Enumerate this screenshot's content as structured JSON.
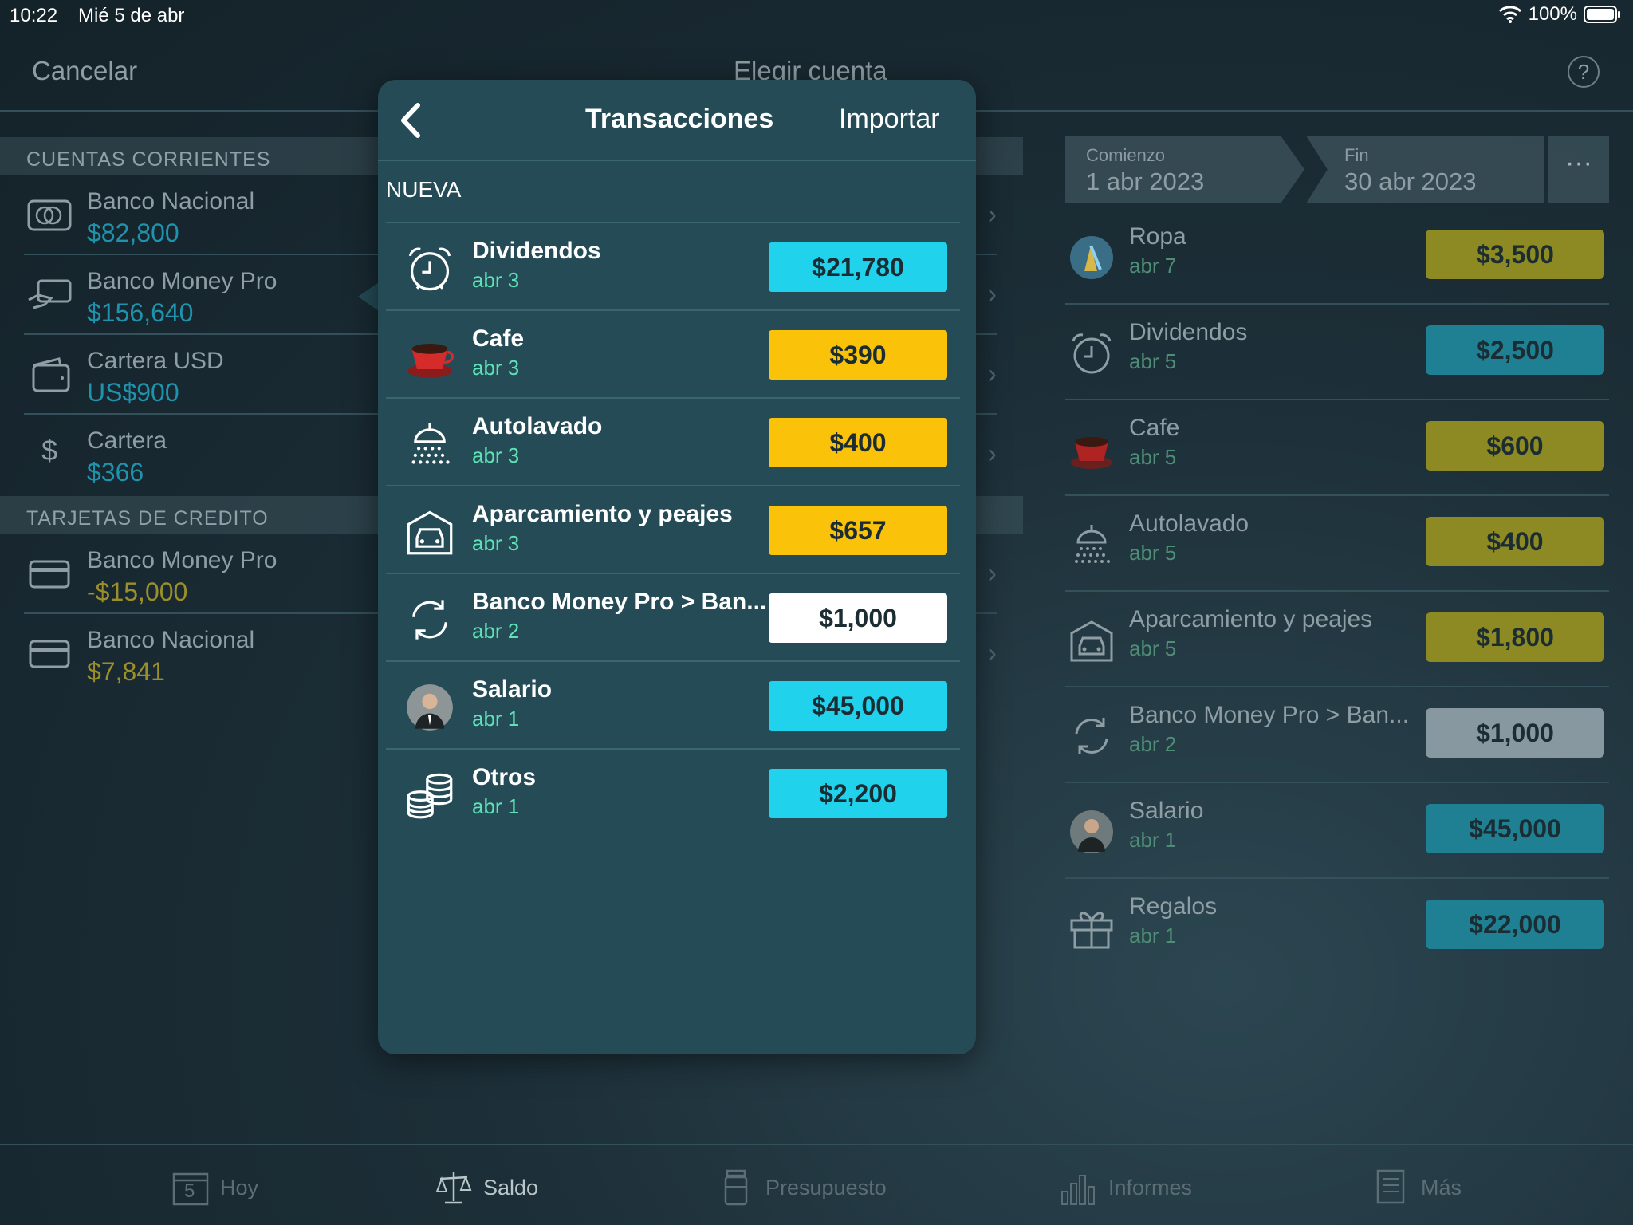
{
  "status": {
    "time": "10:22",
    "date": "Mié 5 de abr",
    "battery": "100%"
  },
  "nav": {
    "cancel": "Cancelar",
    "title": "Elegir cuenta",
    "help": "?"
  },
  "sections": {
    "current": "CUENTAS CORRIENTES",
    "credit": "TARJETAS DE CREDITO"
  },
  "accounts": [
    {
      "name": "Banco Nacional",
      "amount": "$82,800",
      "icon": "bank-card-icon"
    },
    {
      "name": "Banco Money Pro",
      "amount": "$156,640",
      "icon": "hand-card-icon"
    },
    {
      "name": "Cartera USD",
      "amount": "US$900",
      "icon": "wallet-icon"
    },
    {
      "name": "Cartera",
      "amount": "$366",
      "icon": "dollar-icon"
    }
  ],
  "credit_accounts": [
    {
      "name": "Banco Money Pro",
      "amount": "-$15,000",
      "icon": "credit-card-icon"
    },
    {
      "name": "Banco Nacional",
      "amount": "$7,841",
      "icon": "credit-card-icon"
    }
  ],
  "period": {
    "start_label": "Comienzo",
    "start": "1 abr 2023",
    "end_label": "Fin",
    "end": "30 abr 2023",
    "more": "···"
  },
  "right_transactions": [
    {
      "name": "Ropa",
      "date": "abr 7",
      "amount": "$3,500",
      "icon": "clothing-icon"
    },
    {
      "name": "Dividendos",
      "date": "abr 5",
      "amount": "$2,500",
      "icon": "alarm-clock-icon"
    },
    {
      "name": "Cafe",
      "date": "abr 5",
      "amount": "$600",
      "icon": "coffee-cup-icon"
    },
    {
      "name": "Autolavado",
      "date": "abr 5",
      "amount": "$400",
      "icon": "car-wash-icon"
    },
    {
      "name": "Aparcamiento y peajes",
      "date": "abr 5",
      "amount": "$1,800",
      "icon": "garage-car-icon"
    },
    {
      "name": "Banco Money Pro > Ban...",
      "date": "abr 2",
      "amount": "$1,000",
      "icon": "transfer-icon"
    },
    {
      "name": "Salario",
      "date": "abr 1",
      "amount": "$45,000",
      "icon": "person-avatar-icon"
    },
    {
      "name": "Regalos",
      "date": "abr 1",
      "amount": "$22,000",
      "icon": "gift-icon"
    }
  ],
  "popover": {
    "title": "Transacciones",
    "import": "Importar",
    "section": "NUEVA",
    "transactions": [
      {
        "name": "Dividendos",
        "date": "abr 3",
        "amount": "$21,780",
        "icon": "alarm-clock-icon"
      },
      {
        "name": "Cafe",
        "date": "abr 3",
        "amount": "$390",
        "icon": "coffee-cup-icon"
      },
      {
        "name": "Autolavado",
        "date": "abr 3",
        "amount": "$400",
        "icon": "car-wash-icon"
      },
      {
        "name": "Aparcamiento y peajes",
        "date": "abr 3",
        "amount": "$657",
        "icon": "garage-car-icon"
      },
      {
        "name": "Banco Money Pro > Ban...",
        "date": "abr 2",
        "amount": "$1,000",
        "icon": "transfer-icon"
      },
      {
        "name": "Salario",
        "date": "abr 1",
        "amount": "$45,000",
        "icon": "person-avatar-icon"
      },
      {
        "name": "Otros",
        "date": "abr 1",
        "amount": "$2,200",
        "icon": "coins-icon"
      }
    ]
  },
  "tabs": [
    {
      "label": "Hoy",
      "icon": "calendar-icon",
      "calendar_day": "5"
    },
    {
      "label": "Saldo",
      "icon": "scales-icon"
    },
    {
      "label": "Presupuesto",
      "icon": "jar-icon"
    },
    {
      "label": "Informes",
      "icon": "bar-chart-icon"
    },
    {
      "label": "Más",
      "icon": "document-icon"
    }
  ],
  "colors": {
    "positive_amount": "#1f93ad",
    "negative_amount": "#9a8f2a",
    "popover_bg": "#244b56",
    "chip_cyan": "#21d2ed",
    "chip_yellow": "#fac30a"
  }
}
